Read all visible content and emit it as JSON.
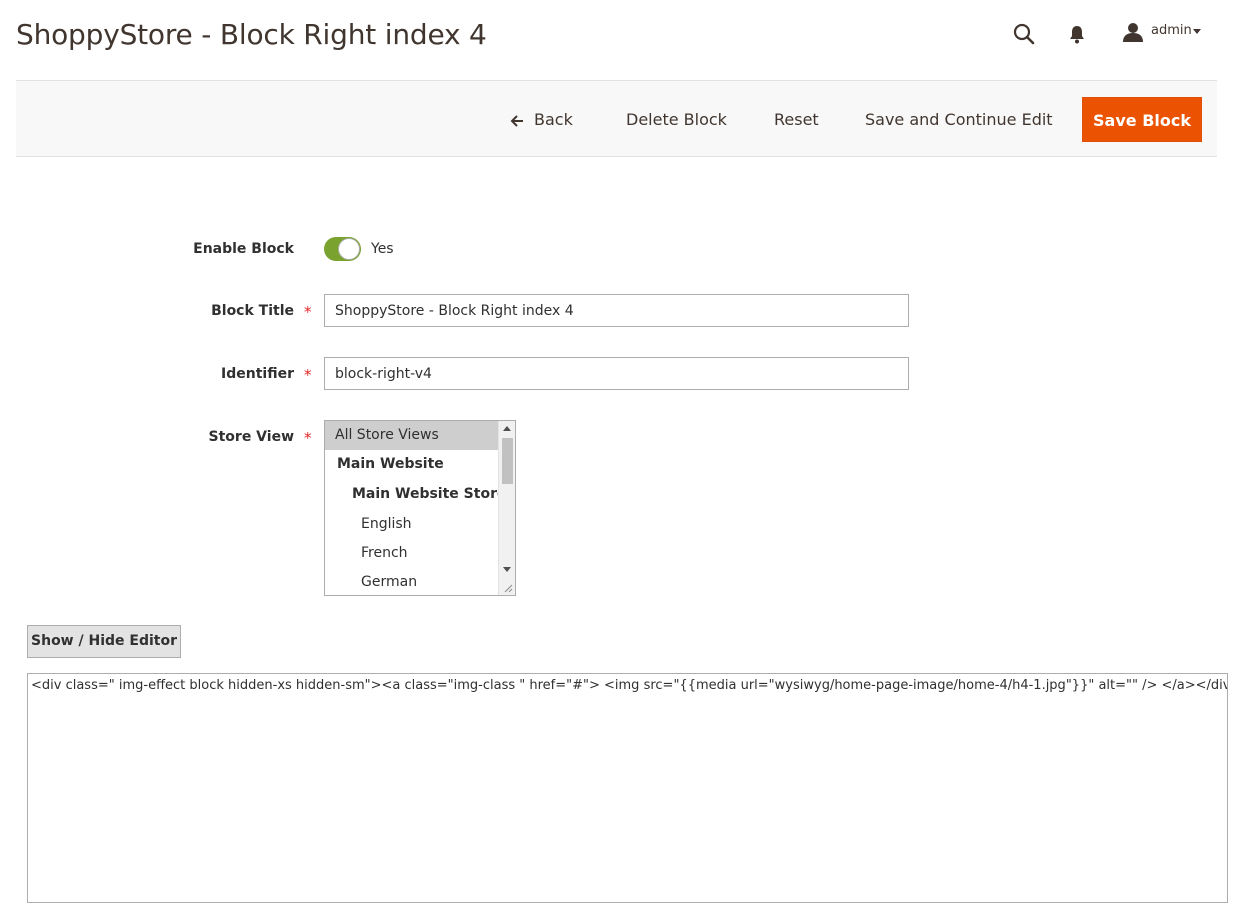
{
  "header": {
    "title": "ShoppyStore - Block Right index 4",
    "user_label": "admin",
    "icons": [
      "search-icon",
      "bell-icon",
      "user-icon",
      "chevron-down-icon"
    ]
  },
  "toolbar": {
    "back_label": "Back",
    "delete_label": "Delete Block",
    "reset_label": "Reset",
    "save_continue_label": "Save and Continue Edit",
    "save_label": "Save Block",
    "accent_color": "#eb5202"
  },
  "form": {
    "enable_block": {
      "label": "Enable Block",
      "value": "Yes",
      "enabled": true,
      "toggle_color": "#79a22e"
    },
    "block_title": {
      "label": "Block Title",
      "value": "ShoppyStore - Block Right index 4",
      "required": "*"
    },
    "identifier": {
      "label": "Identifier",
      "value": "block-right-v4",
      "required": "*"
    },
    "store_view": {
      "label": "Store View",
      "required": "*",
      "options": [
        {
          "text": "All Store Views",
          "selected": true
        },
        {
          "text": "Main Website"
        },
        {
          "text": "Main Website Store"
        },
        {
          "text": "English"
        },
        {
          "text": "French"
        },
        {
          "text": "German"
        }
      ]
    }
  },
  "editor": {
    "toggle_label": "Show / Hide Editor",
    "content": "<div class=\" img-effect  block hidden-xs hidden-sm\"><a class=\"img-class \" href=\"#\"> <img src=\"{{media url=\"wysiwyg/home-page-image/home-4/h4-1.jpg\"}}\" alt=\"\" /> </a></div>"
  }
}
